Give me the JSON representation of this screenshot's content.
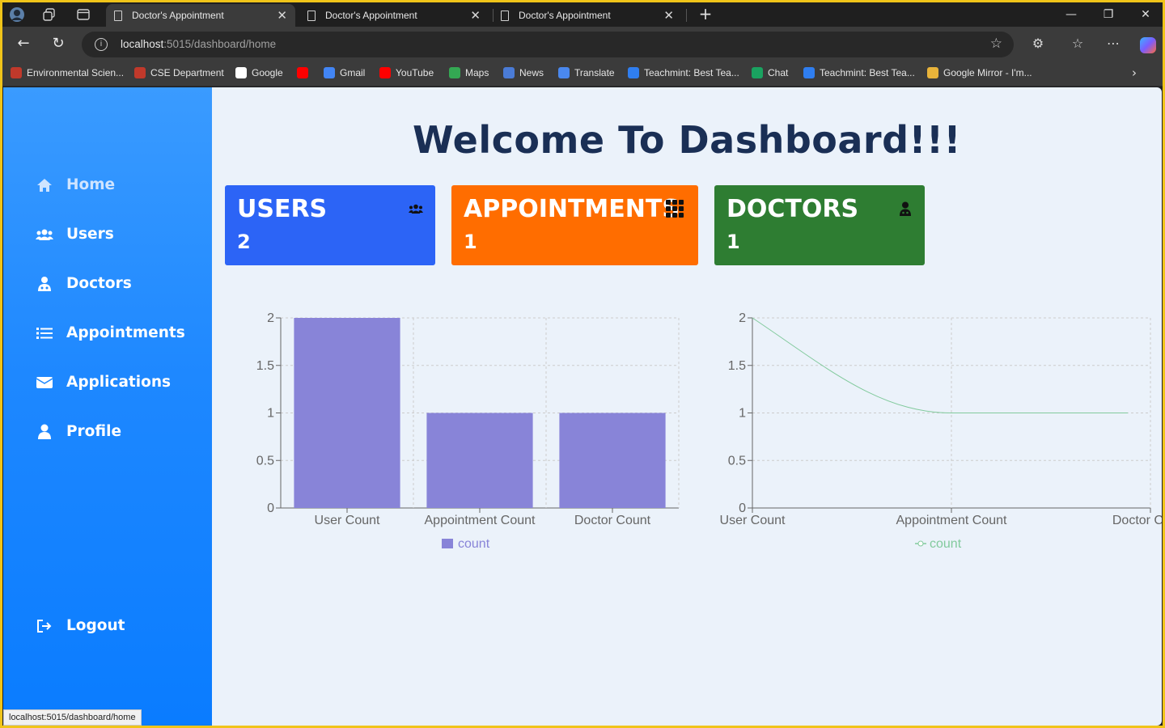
{
  "browser": {
    "tabs": [
      {
        "title": "Doctor's Appointment",
        "active": true
      },
      {
        "title": "Doctor's Appointment",
        "active": false
      },
      {
        "title": "Doctor's Appointment",
        "active": false
      }
    ],
    "url_host": "localhost",
    "url_path": ":5015/dashboard/home",
    "bookmarks": [
      {
        "label": "Environmental Scien...",
        "icon": "app-icon",
        "color": "#c0392b"
      },
      {
        "label": "CSE Department",
        "icon": "app-icon",
        "color": "#c0392b"
      },
      {
        "label": "Google",
        "icon": "google-icon",
        "color": "#ffffff"
      },
      {
        "label": "",
        "icon": "youtube-icon",
        "color": "#ff0000"
      },
      {
        "label": "Gmail",
        "icon": "gmail-icon",
        "color": "#4285f4"
      },
      {
        "label": "YouTube",
        "icon": "youtube-icon",
        "color": "#ff0000"
      },
      {
        "label": "Maps",
        "icon": "maps-icon",
        "color": "#34a853"
      },
      {
        "label": "News",
        "icon": "news-icon",
        "color": "#4a7bd6"
      },
      {
        "label": "Translate",
        "icon": "translate-icon",
        "color": "#4a88ee"
      },
      {
        "label": "Teachmint: Best Tea...",
        "icon": "teachmint-icon",
        "color": "#2f7ef0"
      },
      {
        "label": "Chat",
        "icon": "chat-icon",
        "color": "#1aa260"
      },
      {
        "label": "Teachmint: Best Tea...",
        "icon": "teachmint-icon",
        "color": "#2f7ef0"
      },
      {
        "label": "Google Mirror - I'm...",
        "icon": "chrome-icon",
        "color": "#e8b33a"
      }
    ],
    "status_url": "localhost:5015/dashboard/home"
  },
  "sidebar": {
    "items": [
      {
        "label": "Home",
        "icon": "home-icon"
      },
      {
        "label": "Users",
        "icon": "users-icon"
      },
      {
        "label": "Doctors",
        "icon": "doctor-icon"
      },
      {
        "label": "Appointments",
        "icon": "list-icon"
      },
      {
        "label": "Applications",
        "icon": "envelope-icon"
      },
      {
        "label": "Profile",
        "icon": "user-icon"
      }
    ],
    "logout": {
      "label": "Logout",
      "icon": "logout-icon"
    }
  },
  "main": {
    "title": "Welcome To Dashboard!!!",
    "cards": [
      {
        "label": "USERS",
        "value": "2",
        "icon": "users-icon",
        "color": "#2c64f6"
      },
      {
        "label": "APPOINTMENTS",
        "value": "1",
        "icon": "grid-icon",
        "color": "#ff6d00"
      },
      {
        "label": "DOCTORS",
        "value": "1",
        "icon": "doctor-icon",
        "color": "#2e7d32"
      }
    ]
  },
  "chart_data": [
    {
      "type": "bar",
      "categories": [
        "User Count",
        "Appointment Count",
        "Doctor Count"
      ],
      "series": [
        {
          "name": "count",
          "values": [
            2,
            1,
            1
          ]
        }
      ],
      "ylim": [
        0,
        2
      ],
      "yticks": [
        "0",
        "0.5",
        "1",
        "1.5",
        "2"
      ],
      "grid": true,
      "legend": "bottom",
      "color": "#8884d8"
    },
    {
      "type": "line",
      "categories": [
        "User Count",
        "Appointment Count",
        "Doctor Count"
      ],
      "series": [
        {
          "name": "count",
          "values": [
            2,
            1,
            1
          ]
        }
      ],
      "ylim": [
        0,
        2
      ],
      "yticks": [
        "0",
        "0.5",
        "1",
        "1.5",
        "2"
      ],
      "grid": true,
      "legend": "bottom",
      "color": "#82ca9d"
    }
  ]
}
